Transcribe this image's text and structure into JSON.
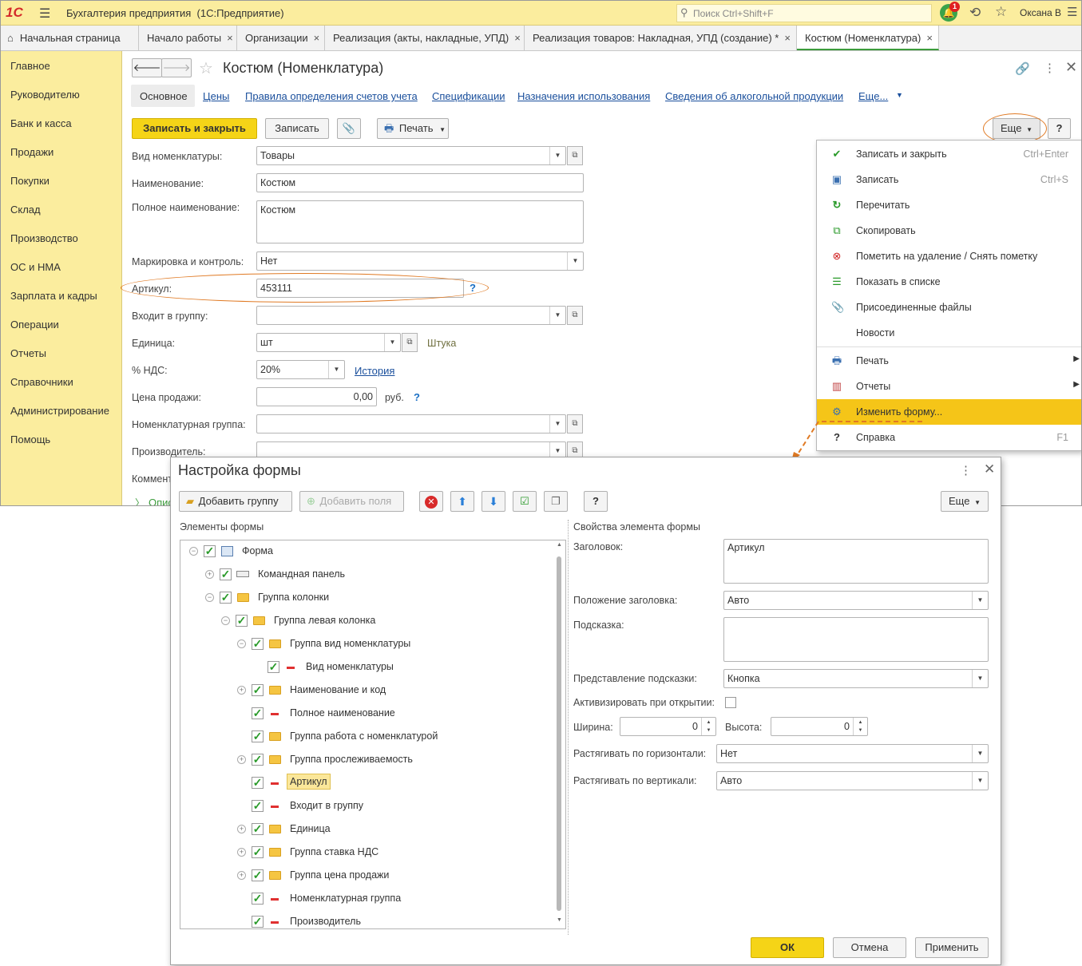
{
  "app": {
    "logo": "1С",
    "title": "Бухгалтерия предприятия  (1С:Предприятие)",
    "search_placeholder": "Поиск Ctrl+Shift+F",
    "notifications_count": "1",
    "user": "Оксана В"
  },
  "tabs": [
    {
      "label": "Начальная страница"
    },
    {
      "label": "Начало работы"
    },
    {
      "label": "Организации"
    },
    {
      "label": "Реализация (акты, накладные, УПД)"
    },
    {
      "label": "Реализация товаров: Накладная, УПД (создание) *"
    },
    {
      "label": "Костюм (Номенклатура)"
    }
  ],
  "tab_close": "×",
  "sidebar": [
    "Главное",
    "Руководителю",
    "Банк и касса",
    "Продажи",
    "Покупки",
    "Склад",
    "Производство",
    "ОС и НМА",
    "Зарплата и кадры",
    "Операции",
    "Отчеты",
    "Справочники",
    "Администрирование",
    "Помощь"
  ],
  "form": {
    "title": "Костюм (Номенклатура)",
    "nav": [
      "Основное",
      "Цены",
      "Правила определения счетов учета",
      "Спецификации",
      "Назначения использования",
      "Сведения об алкогольной продукции",
      "Еще..."
    ],
    "save_close": "Записать и закрыть",
    "save": "Записать",
    "print": "Печать",
    "more": "Еще",
    "help": "?",
    "fields": {
      "vid_label": "Вид номенклатуры:",
      "vid_value": "Товары",
      "name_label": "Наименование:",
      "name_value": "Костюм",
      "fullname_label": "Полное наименование:",
      "fullname_value": "Костюм",
      "mark_label": "Маркировка и контроль:",
      "mark_value": "Нет",
      "art_label": "Артикул:",
      "art_value": "453111",
      "group_label": "Входит в группу:",
      "group_value": "",
      "unit_label": "Единица:",
      "unit_value": "шт",
      "unit_desc": "Штука",
      "nds_label": "% НДС:",
      "nds_value": "20%",
      "nds_history": "История",
      "price_label": "Цена продажи:",
      "price_value": "0,00",
      "price_cur": "руб.",
      "nomgroup_label": "Номенклатурная группа:",
      "maker_label": "Производитель:",
      "comment_label": "Комментарий:",
      "more_link": "Описание"
    }
  },
  "menu": {
    "items": [
      {
        "label": "Записать и закрыть",
        "shortcut": "Ctrl+Enter",
        "icon": "save-close-icon"
      },
      {
        "label": "Записать",
        "shortcut": "Ctrl+S",
        "icon": "floppy-icon"
      },
      {
        "label": "Перечитать",
        "shortcut": "",
        "icon": "refresh-icon"
      },
      {
        "label": "Скопировать",
        "shortcut": "",
        "icon": "copy-icon"
      },
      {
        "label": "Пометить на удаление / Снять пометку",
        "shortcut": "",
        "icon": "delete-mark-icon"
      },
      {
        "label": "Показать в списке",
        "shortcut": "",
        "icon": "show-in-list-icon"
      },
      {
        "label": "Присоединенные файлы",
        "shortcut": "",
        "icon": "paperclip-icon"
      },
      {
        "label": "Новости",
        "shortcut": "",
        "icon": ""
      },
      {
        "label": "Печать",
        "shortcut": "",
        "icon": "printer-icon"
      },
      {
        "label": "Отчеты",
        "shortcut": "",
        "icon": "report-icon"
      },
      {
        "label": "Изменить форму...",
        "shortcut": "",
        "icon": "form-settings-icon"
      },
      {
        "label": "Справка",
        "shortcut": "F1",
        "icon": "question-icon"
      }
    ]
  },
  "dialog": {
    "title": "Настройка формы",
    "add_group": "Добавить группу",
    "add_fields": "Добавить поля",
    "more": "Еще",
    "help": "?",
    "elements_header": "Элементы формы",
    "props_header": "Свойства элемента формы",
    "tree": [
      {
        "label": "Форма"
      },
      {
        "label": "Командная панель"
      },
      {
        "label": "Группа колонки"
      },
      {
        "label": "Группа левая колонка"
      },
      {
        "label": "Группа вид номенклатуры"
      },
      {
        "label": "Вид номенклатуры"
      },
      {
        "label": "Наименование и код"
      },
      {
        "label": "Полное наименование"
      },
      {
        "label": "Группа работа с номенклатурой"
      },
      {
        "label": "Группа прослеживаемость"
      },
      {
        "label": "Артикул"
      },
      {
        "label": "Входит в группу"
      },
      {
        "label": "Единица"
      },
      {
        "label": "Группа ставка НДС"
      },
      {
        "label": "Группа цена продажи"
      },
      {
        "label": "Номенклатурная группа"
      },
      {
        "label": "Производитель"
      }
    ],
    "props": {
      "title_label": "Заголовок:",
      "title_value": "Артикул",
      "title_pos_label": "Положение заголовка:",
      "title_pos_value": "Авто",
      "hint_label": "Подсказка:",
      "hint_value": "",
      "hint_view_label": "Представление подсказки:",
      "hint_view_value": "Кнопка",
      "activate_label": "Активизировать при открытии:",
      "width_label": "Ширина:",
      "width_value": "0",
      "height_label": "Высота:",
      "height_value": "0",
      "hstretch_label": "Растягивать по горизонтали:",
      "hstretch_value": "Нет",
      "vstretch_label": "Растягивать по вертикали:",
      "vstretch_value": "Авто"
    },
    "ok": "ОК",
    "cancel": "Отмена",
    "apply": "Применить"
  },
  "colors": {
    "accent_yellow": "#f5d417",
    "sidebar": "#fbed9e",
    "highlight": "#f5c518",
    "callout": "#e07a24"
  }
}
